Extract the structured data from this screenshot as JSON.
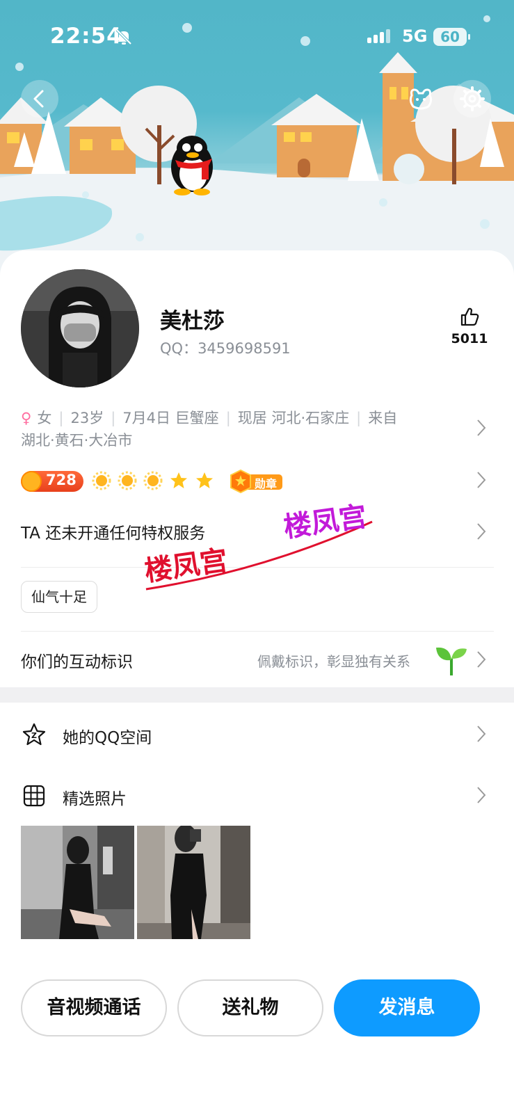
{
  "status_bar": {
    "time": "22:54",
    "network": "5G",
    "battery": "60"
  },
  "header": {
    "back_icon": "chevron-left-icon",
    "pet_icon": "pet-paw-icon",
    "settings_icon": "gear-icon"
  },
  "profile": {
    "name": "美杜莎",
    "qq_label": "QQ：",
    "qq_number": "3459698591",
    "like_count": "5011"
  },
  "info": {
    "gender_symbol": "♀",
    "gender": "女",
    "age": "23岁",
    "birthday": "7月4日 巨蟹座",
    "location": "现居 河北·石家庄",
    "hometown": "来自",
    "hometown_detail": "湖北·黄石·大冶市"
  },
  "level": {
    "value": "728",
    "badge_label": "勋章"
  },
  "privilege_text": "TA 还未开通任何特权服务",
  "tags": [
    "仙气十足"
  ],
  "interaction": {
    "title": "你们的互动标识",
    "hint": "佩戴标识，彰显独有关系"
  },
  "list": {
    "qzone": "她的QQ空间",
    "photos": "精选照片"
  },
  "actions": {
    "call": "音视频通话",
    "gift": "送礼物",
    "message": "发消息"
  },
  "watermark": "楼凤宫",
  "colors": {
    "primary": "#0e9bff",
    "sky": "#56b9cc",
    "level_pill": "#e8401c"
  }
}
